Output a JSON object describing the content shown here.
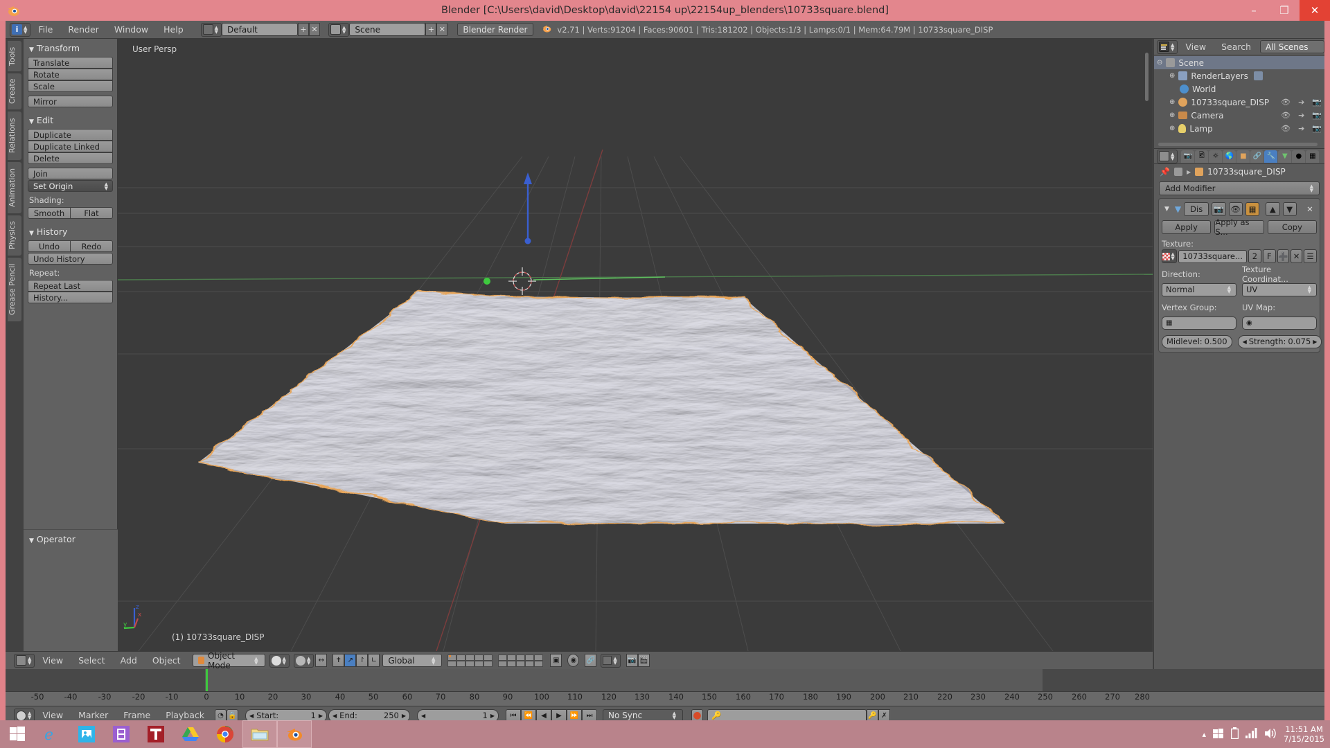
{
  "window": {
    "title": "Blender [C:\\Users\\david\\Desktop\\david\\22154 up\\22154up_blenders\\10733square.blend]",
    "minimize": "–",
    "maximize": "❐",
    "close": "✕"
  },
  "info_header": {
    "menus": [
      "File",
      "Render",
      "Window",
      "Help"
    ],
    "screen_layout": "Default",
    "scene": "Scene",
    "render_engine": "Blender Render",
    "status": "v2.71 | Verts:91204 | Faces:90601 | Tris:181202 | Objects:1/3 | Lamps:0/1 | Mem:64.79M | 10733square_DISP",
    "add_label": "+",
    "x_label": "✕"
  },
  "toolshelf": {
    "tabs": [
      "Tools",
      "Create",
      "Relations",
      "Animation",
      "Physics",
      "Grease Pencil"
    ],
    "panels": [
      {
        "title": "Transform",
        "buttons": [
          "Translate",
          "Rotate",
          "Scale"
        ],
        "single": [
          "Mirror"
        ]
      },
      {
        "title": "Edit",
        "buttons": [
          "Duplicate",
          "Duplicate Linked",
          "Delete"
        ],
        "single": [
          "Join"
        ],
        "dropdown": "Set Origin",
        "shading_label": "Shading:",
        "shading": [
          "Smooth",
          "Flat"
        ]
      },
      {
        "title": "History",
        "undo_redo": [
          "Undo",
          "Redo"
        ],
        "undo_history": "Undo History",
        "repeat_label": "Repeat:",
        "repeat": [
          "Repeat Last",
          "History..."
        ]
      }
    ],
    "operator_panel": "Operator"
  },
  "viewport": {
    "perspective_label": "User Persp",
    "object_label": "(1) 10733square_DISP",
    "axis": {
      "x": "x",
      "y": "y",
      "z": "z"
    }
  },
  "view3d_header": {
    "menus": [
      "View",
      "Select",
      "Add",
      "Object"
    ],
    "mode": "Object Mode",
    "transform_orientation": "Global"
  },
  "timeline": {
    "menus": [
      "View",
      "Marker",
      "Frame",
      "Playback"
    ],
    "start_label": "Start:",
    "start_value": "1",
    "end_label": "End:",
    "end_value": "250",
    "current_frame": "1",
    "sync_mode": "No Sync",
    "ticks": [
      "-50",
      "-40",
      "-30",
      "-20",
      "-10",
      "0",
      "10",
      "20",
      "30",
      "40",
      "50",
      "60",
      "70",
      "80",
      "90",
      "100",
      "110",
      "120",
      "130",
      "140",
      "150",
      "160",
      "170",
      "180",
      "190",
      "200",
      "210",
      "220",
      "230",
      "240",
      "250",
      "260",
      "270",
      "280"
    ],
    "playhead_frame": 0
  },
  "outliner": {
    "header": {
      "view": "View",
      "search": "Search",
      "display_mode": "All Scenes"
    },
    "rows": [
      {
        "label": "Scene",
        "indent": 0,
        "icon": "scene-icon",
        "selected": true,
        "expander": "⊖",
        "icons": []
      },
      {
        "label": "RenderLayers",
        "indent": 1,
        "icon": "renderlayers-icon",
        "selected": false,
        "expander": "⊕",
        "icons": []
      },
      {
        "label": "World",
        "indent": 1,
        "icon": "world-icon",
        "selected": false,
        "expander": "",
        "icons": []
      },
      {
        "label": "10733square_DISP",
        "indent": 1,
        "icon": "mesh-icon",
        "selected": false,
        "expander": "⊕",
        "icons": [
          "eye",
          "cursor",
          "camera"
        ]
      },
      {
        "label": "Camera",
        "indent": 1,
        "icon": "camera-icon",
        "selected": false,
        "expander": "⊕",
        "icons": [
          "eye",
          "cursor",
          "camera"
        ]
      },
      {
        "label": "Lamp",
        "indent": 1,
        "icon": "lamp-icon",
        "selected": false,
        "expander": "⊕",
        "icons": [
          "eye",
          "cursor",
          "camera"
        ]
      }
    ]
  },
  "properties": {
    "tabs": [
      "render",
      "render-layers",
      "scene",
      "world",
      "object",
      "constraints",
      "modifiers",
      "data",
      "material",
      "texture"
    ],
    "active_tab_index": 6,
    "breadcrumb_object": "10733square_DISP",
    "add_modifier": "Add Modifier",
    "modifier": {
      "name": "Dis",
      "apply": "Apply",
      "apply_as_shape": "Apply as S...",
      "copy": "Copy",
      "texture_label": "Texture:",
      "texture_name": "10733square...",
      "texture_users": "2",
      "texture_fake_user": "F",
      "direction_label": "Direction:",
      "direction_value": "Normal",
      "texture_coords_label": "Texture Coordinat...",
      "texture_coords_value": "UV",
      "vertex_group_label": "Vertex Group:",
      "vertex_group_value": "",
      "uv_map_label": "UV Map:",
      "uv_map_value": "",
      "midlevel_label": "Midlevel:",
      "midlevel_value": "0.500",
      "strength_label": "Strength:",
      "strength_value": "0.075"
    }
  },
  "taskbar": {
    "items": [
      {
        "name": "start-button",
        "icon": "windows-logo"
      },
      {
        "name": "internet-explorer",
        "icon": "ie-logo"
      },
      {
        "name": "photos-app",
        "icon": "photo-icon"
      },
      {
        "name": "video-app",
        "icon": "film-icon"
      },
      {
        "name": "texturing-app",
        "icon": "t-logo"
      },
      {
        "name": "google-drive",
        "icon": "drive-logo"
      },
      {
        "name": "google-chrome",
        "icon": "chrome-logo"
      },
      {
        "name": "file-explorer",
        "icon": "folder-icon"
      },
      {
        "name": "blender-app",
        "icon": "blender-logo"
      }
    ],
    "tray": {
      "show_hidden": "▴",
      "network": "network-icon",
      "battery": "battery-icon",
      "signal": "signal-icon",
      "volume": "volume-icon"
    },
    "time": "11:51 AM",
    "date": "7/15/2015"
  },
  "colors": {
    "title_bar": "#e3868d",
    "taskbar": "#b9838b",
    "accent_blue": "#4a7fc1",
    "playhead_green": "#3ec93e",
    "selection_orange": "#e8a65a",
    "axis_red": "#c34a4a",
    "axis_green": "#4ab44a",
    "axis_blue": "#3a5fd0"
  }
}
